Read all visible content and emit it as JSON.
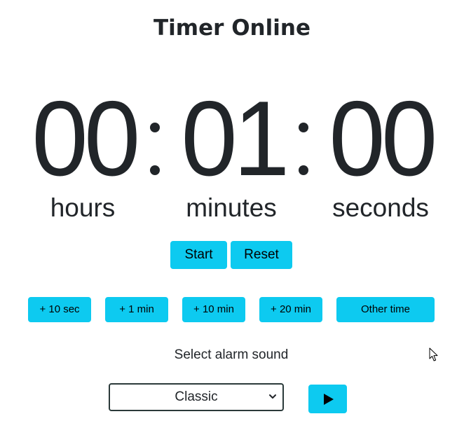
{
  "title": "Timer Online",
  "time": {
    "hours": "00",
    "minutes": "01",
    "seconds": "00"
  },
  "units": {
    "hours": "hours",
    "minutes": "minutes",
    "seconds": "seconds"
  },
  "controls": {
    "start_label": "Start",
    "reset_label": "Reset"
  },
  "presets": [
    {
      "label": "+ 10 sec"
    },
    {
      "label": "+ 1 min"
    },
    {
      "label": "+ 10 min"
    },
    {
      "label": "+ 20 min"
    },
    {
      "label": "Other time"
    }
  ],
  "alarm": {
    "label": "Select alarm sound",
    "selected": "Classic",
    "play_icon": "play-icon"
  },
  "colors": {
    "button_bg": "#0dcaf0",
    "text": "#212529"
  }
}
